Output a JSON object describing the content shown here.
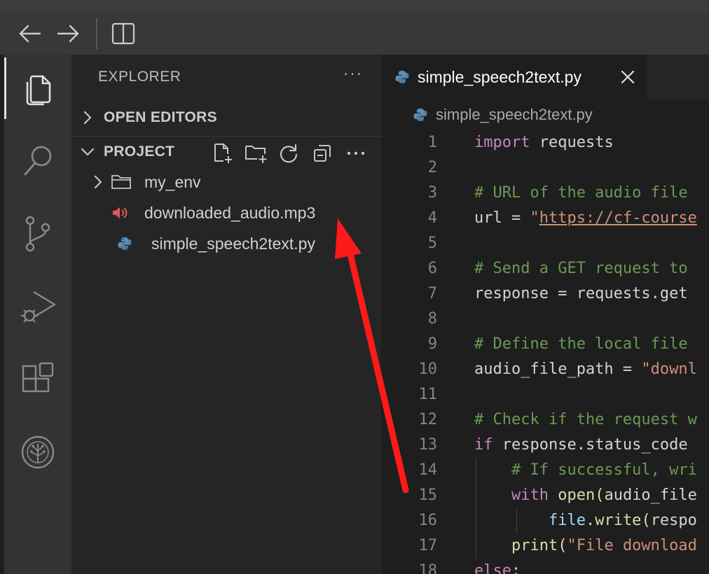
{
  "nav": {
    "back_icon": "arrow-left-icon",
    "forward_icon": "arrow-right-icon",
    "layout_icon": "split-editor-icon"
  },
  "activity_bar": {
    "items": [
      {
        "icon": "files-icon",
        "active": true
      },
      {
        "icon": "search-icon"
      },
      {
        "icon": "source-control-icon"
      },
      {
        "icon": "run-debug-icon"
      },
      {
        "icon": "extensions-icon"
      },
      {
        "icon": "tree-logo-icon"
      }
    ]
  },
  "sidebar": {
    "title": "EXPLORER",
    "more": "···",
    "open_editors_label": "OPEN EDITORS",
    "project_label": "PROJECT",
    "tools": [
      "new-file-icon",
      "new-folder-icon",
      "refresh-icon",
      "collapse-all-icon",
      "more-icon"
    ],
    "tree": [
      {
        "name": "my_env",
        "type": "folder"
      },
      {
        "name": "downloaded_audio.mp3",
        "type": "audio"
      },
      {
        "name": "simple_speech2text.py",
        "type": "python"
      }
    ]
  },
  "editor": {
    "tab_label": "simple_speech2text.py",
    "breadcrumb": "simple_speech2text.py",
    "lines": [
      {
        "n": "1",
        "indent": 0,
        "tokens": [
          [
            "kw",
            "import"
          ],
          [
            "id",
            " requests"
          ]
        ]
      },
      {
        "n": "2",
        "indent": 0,
        "tokens": []
      },
      {
        "n": "3",
        "indent": 0,
        "tokens": [
          [
            "cm",
            "# URL of the audio file"
          ]
        ]
      },
      {
        "n": "4",
        "indent": 0,
        "tokens": [
          [
            "id",
            "url = "
          ],
          [
            "st",
            "\""
          ],
          [
            "st ul",
            "https://cf-course"
          ]
        ]
      },
      {
        "n": "5",
        "indent": 0,
        "tokens": []
      },
      {
        "n": "6",
        "indent": 0,
        "tokens": [
          [
            "cm",
            "# Send a GET request to"
          ]
        ]
      },
      {
        "n": "7",
        "indent": 0,
        "tokens": [
          [
            "id",
            "response = requests.get"
          ]
        ]
      },
      {
        "n": "8",
        "indent": 0,
        "tokens": []
      },
      {
        "n": "9",
        "indent": 0,
        "tokens": [
          [
            "cm",
            "# Define the local file"
          ]
        ]
      },
      {
        "n": "10",
        "indent": 0,
        "tokens": [
          [
            "id",
            "audio_file_path = "
          ],
          [
            "st",
            "\"downl"
          ]
        ]
      },
      {
        "n": "11",
        "indent": 0,
        "tokens": []
      },
      {
        "n": "12",
        "indent": 0,
        "tokens": [
          [
            "cm",
            "# Check if the request w"
          ]
        ]
      },
      {
        "n": "13",
        "indent": 0,
        "tokens": [
          [
            "kw",
            "if"
          ],
          [
            "id",
            " response.status_code"
          ]
        ]
      },
      {
        "n": "14",
        "indent": 1,
        "tokens": [
          [
            "cm",
            "    # If successful, wri"
          ]
        ]
      },
      {
        "n": "15",
        "indent": 1,
        "tokens": [
          [
            "id",
            "    "
          ],
          [
            "kw",
            "with"
          ],
          [
            "id",
            " "
          ],
          [
            "fn",
            "open"
          ],
          [
            "fn",
            "("
          ],
          [
            "id",
            "audio_file"
          ]
        ]
      },
      {
        "n": "16",
        "indent": 2,
        "tokens": [
          [
            "id",
            "        "
          ],
          [
            "vr",
            "file"
          ],
          [
            "id",
            "."
          ],
          [
            "fn",
            "write"
          ],
          [
            "fn",
            "("
          ],
          [
            "id",
            "respo"
          ]
        ]
      },
      {
        "n": "17",
        "indent": 1,
        "tokens": [
          [
            "id",
            "    "
          ],
          [
            "fn",
            "print"
          ],
          [
            "fn",
            "("
          ],
          [
            "st",
            "\"File download"
          ]
        ]
      },
      {
        "n": "18",
        "indent": 0,
        "tokens": [
          [
            "kw",
            "else"
          ],
          [
            "id",
            ":"
          ]
        ]
      }
    ]
  },
  "colors": {
    "annotation_arrow": "#ff1a1a",
    "audio_icon": "#e05a5a",
    "python_icon": "#5b8fb9"
  }
}
